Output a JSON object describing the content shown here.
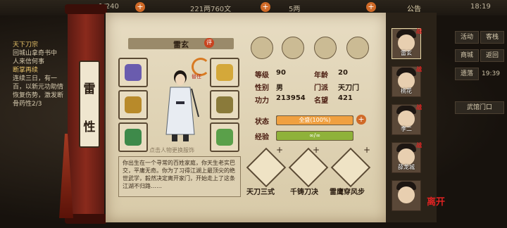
{
  "topbar": {
    "stamina": "1/240",
    "silver": "221两760文",
    "gold": "5两",
    "announce": "公告",
    "time": "18:19"
  },
  "left_panel": {
    "title": "天下刀宗",
    "lines": [
      "回城山拿奇书中",
      "人来信何事"
    ],
    "quest": "断掌再续",
    "quest_lines": [
      "连续三日，有一",
      "百，以新元功助情",
      "恢复伤势，激发断",
      "骨药性2/3"
    ]
  },
  "vertical_title": [
    "雷",
    "性"
  ],
  "hero": {
    "name": "雷玄",
    "rank_badge": "评",
    "swap_label": "替任"
  },
  "stats": {
    "level_label": "等级",
    "level": "90",
    "age_label": "年龄",
    "age": "20",
    "gender_label": "性别",
    "gender": "男",
    "sect_label": "门派",
    "sect": "天刀门",
    "power_label": "功力",
    "power": "213954",
    "fame_label": "名望",
    "fame": "421",
    "status_label": "状态",
    "status_value": "全盛(100%)",
    "status_fraction": 1.0,
    "exp_label": "经验",
    "exp_value": "∞/∞",
    "exp_fraction": 1.0
  },
  "tap_hint": "点击人物更换服饰",
  "description": "你出生在一个寻常的百姓家庭，你天生老实巴交，平庸无奇。你为了习得江湖上最顶尖的绝世武学，毅然决定离开家门，开始走上了这条江湖不归路……",
  "skills": [
    "天刀三式",
    "千铸刀决",
    "雷鹰穿风步"
  ],
  "roster": [
    {
      "name": "雷玄",
      "battle": "战"
    },
    {
      "name": "桃花",
      "battle": "战"
    },
    {
      "name": "李二",
      "battle": "战"
    },
    {
      "name": "薛龙城",
      "battle": "战"
    },
    {
      "name": "",
      "battle": ""
    }
  ],
  "right_menu": {
    "event": "活动",
    "shop": "商城",
    "dragon": "遗落",
    "return": "返回",
    "inn": "客栈",
    "timer": "19:39",
    "martial_gate": "武馆门口",
    "leave": "离开"
  },
  "colors": {
    "status_fill": "#f0a040",
    "exp_fill": "#8fb23a",
    "accent": "#c8431f"
  }
}
